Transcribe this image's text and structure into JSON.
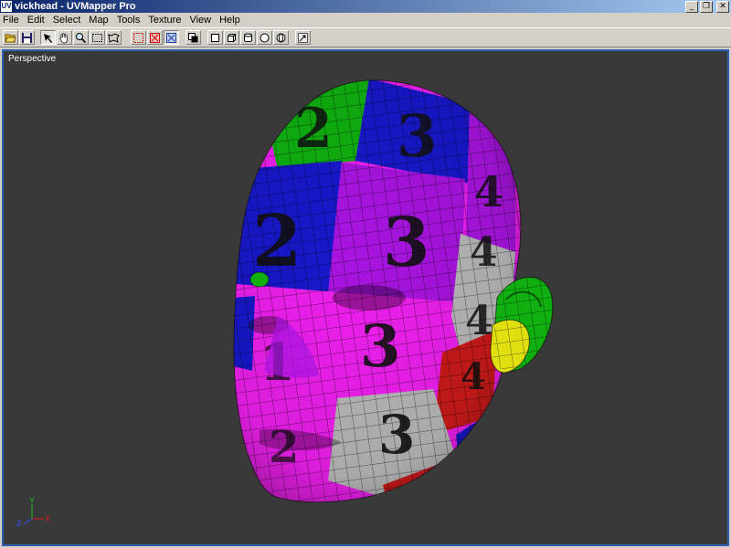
{
  "window": {
    "app_icon_text": "UV",
    "title": "vickhead - UVMapper Pro",
    "minimize_glyph": "_",
    "maximize_glyph": "❐",
    "close_glyph": "✕"
  },
  "menu": [
    "File",
    "Edit",
    "Select",
    "Map",
    "Tools",
    "Texture",
    "View",
    "Help"
  ],
  "toolbar": {
    "tools": [
      {
        "icon": "open-folder-icon"
      },
      {
        "icon": "save-disk-icon"
      },
      {
        "icon": "select-arrow-icon",
        "pressed": true
      },
      {
        "icon": "pan-hand-icon"
      },
      {
        "icon": "zoom-magnifier-icon"
      },
      {
        "icon": "marquee-select-icon"
      },
      {
        "icon": "lasso-select-icon"
      },
      {
        "icon": "selection-mode-red-icon"
      },
      {
        "icon": "selection-mode-red-cross-icon"
      },
      {
        "icon": "selection-mode-blue-cross-icon",
        "pressed": true
      },
      {
        "icon": "layer-copy-icon"
      },
      {
        "icon": "box-primitive-icon"
      },
      {
        "icon": "cube-primitive-icon"
      },
      {
        "icon": "cylinder-primitive-icon"
      },
      {
        "icon": "sphere-primitive-icon"
      },
      {
        "icon": "polar-primitive-icon"
      },
      {
        "icon": "edit-arrow-icon"
      }
    ]
  },
  "viewport": {
    "label": "Perspective",
    "background": "#393939",
    "border_color": "#2f5fb3",
    "axes": {
      "y": "Y",
      "x": "X",
      "z": "Z"
    },
    "uv_tile_numbers": [
      "2",
      "3",
      "4",
      "1",
      "3",
      "4",
      "3"
    ],
    "uv_tile_colors": [
      "#10b010",
      "#1818cc",
      "#a814e0",
      "#ee20ee",
      "#b8b8b8",
      "#cc1a1a",
      "#e0e010"
    ]
  }
}
